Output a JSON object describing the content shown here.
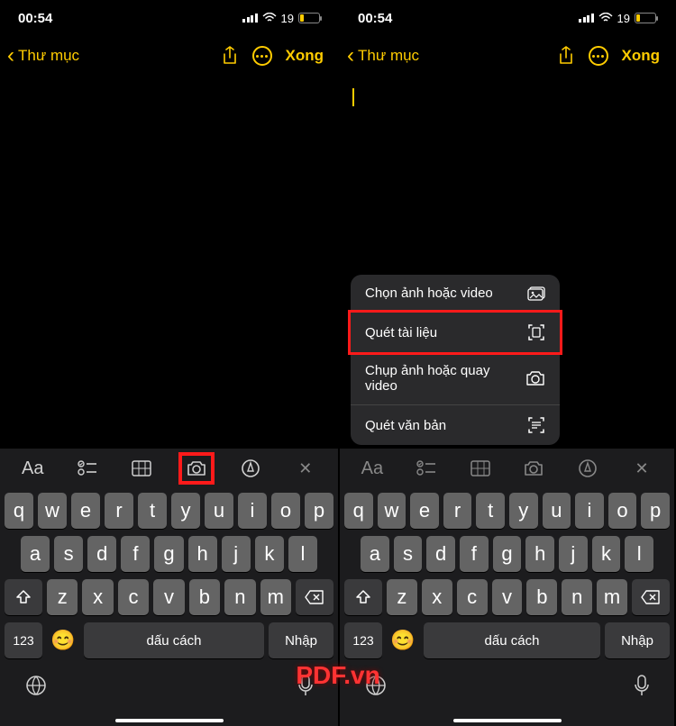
{
  "status": {
    "time": "00:54",
    "battery_pct": "19"
  },
  "header": {
    "back": "Thư mục",
    "done": "Xong"
  },
  "cam_menu": {
    "items": [
      {
        "label": "Chọn ảnh hoặc video",
        "icon": "gallery-icon"
      },
      {
        "label": "Quét tài liệu",
        "icon": "scan-doc-icon",
        "highlight": true
      },
      {
        "label": "Chụp ảnh hoặc quay video",
        "icon": "camera-icon"
      },
      {
        "label": "Quét văn bản",
        "icon": "scan-text-icon"
      }
    ]
  },
  "keyboard": {
    "row1": [
      "q",
      "w",
      "e",
      "r",
      "t",
      "y",
      "u",
      "i",
      "o",
      "p"
    ],
    "row2": [
      "a",
      "s",
      "d",
      "f",
      "g",
      "h",
      "j",
      "k",
      "l"
    ],
    "row3": [
      "z",
      "x",
      "c",
      "v",
      "b",
      "n",
      "m"
    ],
    "num": "123",
    "space": "dấu cách",
    "enter": "Nhập"
  },
  "watermark": "PDF.vn"
}
